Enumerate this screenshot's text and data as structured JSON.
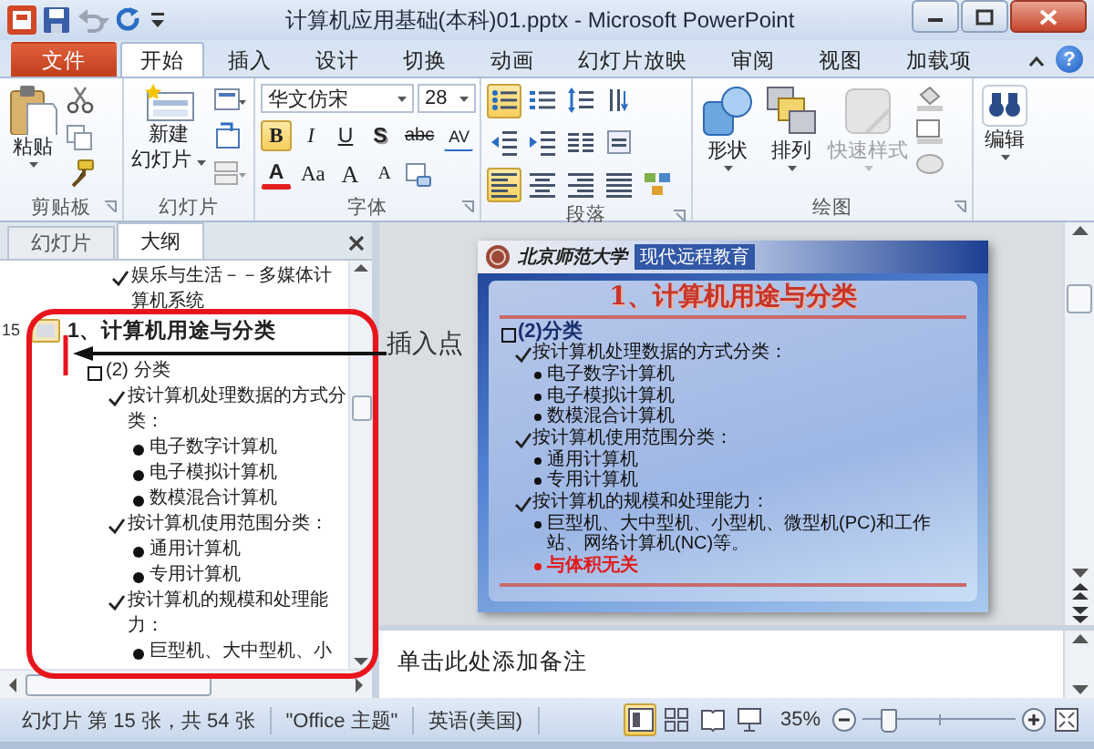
{
  "window": {
    "title": "计算机应用基础(本科)01.pptx - Microsoft PowerPoint"
  },
  "ribbon_tabs": [
    {
      "label": "文件",
      "kind": "file",
      "selected": false
    },
    {
      "label": "开始",
      "kind": "tab",
      "selected": true
    },
    {
      "label": "插入",
      "kind": "tab",
      "selected": false
    },
    {
      "label": "设计",
      "kind": "tab",
      "selected": false
    },
    {
      "label": "切换",
      "kind": "tab",
      "selected": false
    },
    {
      "label": "动画",
      "kind": "tab",
      "selected": false
    },
    {
      "label": "幻灯片放映",
      "kind": "tab",
      "selected": false
    },
    {
      "label": "审阅",
      "kind": "tab",
      "selected": false
    },
    {
      "label": "视图",
      "kind": "tab",
      "selected": false
    },
    {
      "label": "加载项",
      "kind": "tab",
      "selected": false
    }
  ],
  "help_glyph": "?",
  "ribbon": {
    "clipboard": {
      "label": "剪贴板",
      "paste": "粘贴"
    },
    "slides": {
      "label": "幻灯片",
      "new_slide": [
        "新建",
        "幻灯片"
      ]
    },
    "font": {
      "label": "字体",
      "font_name": "华文仿宋",
      "font_size": "28",
      "format_buttons": [
        {
          "glyph": "B",
          "kind": "bold",
          "selected": true
        },
        {
          "glyph": "I",
          "kind": "italic",
          "selected": false
        },
        {
          "glyph": "U",
          "kind": "underline",
          "selected": false
        },
        {
          "glyph": "S",
          "kind": "shadow",
          "selected": false
        },
        {
          "glyph": "abc",
          "kind": "strike",
          "selected": false
        },
        {
          "glyph": "AV",
          "kind": "spacing",
          "selected": false
        }
      ],
      "other_buttons": [
        {
          "glyph": "A",
          "kind": "font_color"
        },
        {
          "glyph": "Aa",
          "kind": "case"
        },
        {
          "glyph": "A",
          "kind": "grow"
        },
        {
          "glyph": "A",
          "kind": "shrink"
        }
      ]
    },
    "paragraph": {
      "label": "段落",
      "tools_rows": [
        [
          {
            "kind": "bullets",
            "selected": true
          },
          {
            "kind": "numbering",
            "selected": false
          },
          {
            "kind": "line_spacing",
            "selected": false
          },
          {
            "kind": "text_direction",
            "selected": false
          }
        ],
        [
          {
            "kind": "outdent",
            "selected": false
          },
          {
            "kind": "indent",
            "selected": false
          },
          {
            "kind": "columns",
            "selected": false
          },
          {
            "kind": "align_text",
            "selected": false
          }
        ],
        [
          {
            "kind": "align_left",
            "selected": true
          },
          {
            "kind": "align_center",
            "selected": false
          },
          {
            "kind": "align_right",
            "selected": false
          },
          {
            "kind": "justify",
            "selected": false
          },
          {
            "kind": "smartart",
            "selected": false
          }
        ]
      ]
    },
    "drawing": {
      "label": "绘图",
      "buttons": [
        {
          "label": "形状",
          "kind": "shapes",
          "disabled": false
        },
        {
          "label": "排列",
          "kind": "arrange",
          "disabled": false
        },
        {
          "label": "快速样式",
          "kind": "styles",
          "disabled": true
        }
      ]
    },
    "editing": {
      "button": "编辑"
    }
  },
  "pane_tabs": [
    {
      "label": "幻灯片",
      "selected": false
    },
    {
      "label": "大纲",
      "selected": true
    }
  ],
  "outline": {
    "continued": {
      "kind": "check",
      "text": "娱乐与生活－－多媒体计算机系统"
    },
    "slides": [
      {
        "number": "15",
        "title": "1、计算机用途与分类",
        "children": [
          {
            "kind": "square",
            "text": "(2) 分类",
            "children": [
              {
                "kind": "check",
                "text": "按计算机处理数据的方式分类：",
                "children": [
                  {
                    "kind": "bullet",
                    "text": "电子数字计算机"
                  },
                  {
                    "kind": "bullet",
                    "text": "电子模拟计算机"
                  },
                  {
                    "kind": "bullet",
                    "text": "数模混合计算机"
                  }
                ]
              },
              {
                "kind": "check",
                "text": "按计算机使用范围分类：",
                "children": [
                  {
                    "kind": "bullet",
                    "text": "通用计算机"
                  },
                  {
                    "kind": "bullet",
                    "text": "专用计算机"
                  }
                ]
              },
              {
                "kind": "check",
                "text": "按计算机的规模和处理能力：",
                "children": [
                  {
                    "kind": "bullet",
                    "text": "巨型机、大中型机、小"
                  }
                ]
              }
            ]
          }
        ]
      }
    ]
  },
  "insert_point_label": "插入点",
  "slide": {
    "logo_text": "北京师范大学",
    "header": "现代远程教育",
    "title": "1、计算机用途与分类",
    "items": [
      {
        "kind": "square",
        "text": "(2)分类",
        "highlight": false,
        "children": [
          {
            "kind": "check",
            "text": "按计算机处理数据的方式分类：",
            "highlight": false,
            "children": [
              {
                "kind": "bullet",
                "text": "电子数字计算机",
                "highlight": false
              },
              {
                "kind": "bullet",
                "text": "电子模拟计算机",
                "highlight": false
              },
              {
                "kind": "bullet",
                "text": "数模混合计算机",
                "highlight": false
              }
            ]
          },
          {
            "kind": "check",
            "text": "按计算机使用范围分类：",
            "highlight": false,
            "children": [
              {
                "kind": "bullet",
                "text": "通用计算机",
                "highlight": false
              },
              {
                "kind": "bullet",
                "text": "专用计算机",
                "highlight": false
              }
            ]
          },
          {
            "kind": "check",
            "text": "按计算机的规模和处理能力：",
            "highlight": false,
            "children": [
              {
                "kind": "bullet",
                "text": "巨型机、大中型机、小型机、微型机(PC)和工作站、网络计算机(NC)等。",
                "highlight": false
              },
              {
                "kind": "bullet",
                "text": "与体积无关",
                "highlight": true
              }
            ]
          }
        ]
      }
    ]
  },
  "notes": {
    "placeholder": "单击此处添加备注"
  },
  "status_bar": {
    "items": [
      "幻灯片 第 15 张，共 54 张",
      "\"Office 主题\"",
      "英语(美国)"
    ],
    "views": [
      {
        "kind": "normal",
        "selected": true
      },
      {
        "kind": "sorter",
        "selected": false
      },
      {
        "kind": "reading",
        "selected": false
      },
      {
        "kind": "slideshow",
        "selected": false
      }
    ],
    "zoom": "35%",
    "zoom_slider": {
      "level": 0.17
    }
  }
}
